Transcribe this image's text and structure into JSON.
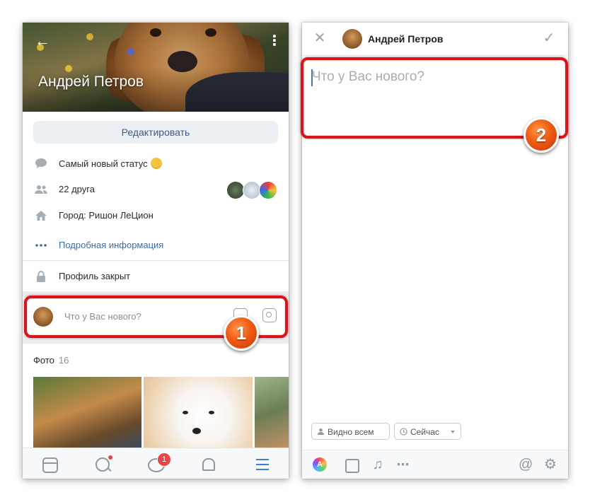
{
  "profile_screen": {
    "name": "Андрей Петров",
    "edit_label": "Редактировать",
    "status": "Самый новый статус",
    "friends": "22 друга",
    "city": "Город: Ришон ЛеЦион",
    "details": "Подробная информация",
    "profile_closed": "Профиль закрыт",
    "composer_placeholder": "Что у Вас нового?",
    "photos_title": "Фото",
    "photos_count": "16",
    "tabbar": {
      "messages_badge": "1"
    },
    "icons": {
      "back": "arrow-left-icon",
      "more": "more-vertical-icon",
      "status": "speech-bubble-icon",
      "friends": "people-icon",
      "city": "home-icon",
      "details": "dots-icon",
      "closed": "lock-icon"
    }
  },
  "post_screen": {
    "author": "Андрей Петров",
    "placeholder": "Что у Вас нового?",
    "visibility": "Видно всем",
    "time": "Сейчас"
  },
  "annotations": {
    "step1": "1",
    "step2": "2"
  },
  "colors": {
    "accent": "#3f7ed1",
    "link": "#3f6ca2",
    "highlight": "#d9141a",
    "badge": "#e64646"
  }
}
